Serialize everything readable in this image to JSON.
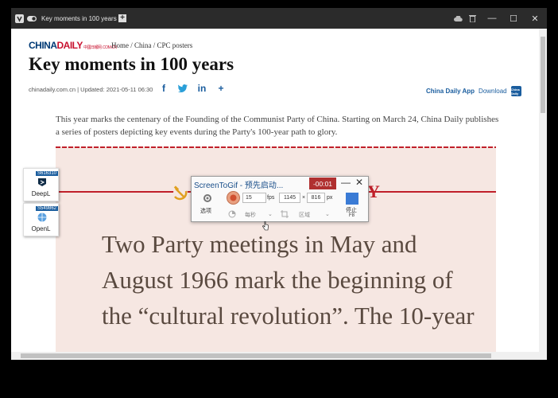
{
  "window": {
    "tab_title": "Key moments in 100 years",
    "new_tab_label": "+",
    "minimize": "—",
    "maximize": "☐",
    "close": "✕"
  },
  "colors": {
    "accent_blue": "#1a5d9e",
    "brand_red": "#c8102e",
    "poster_bg": "#f6e7e2"
  },
  "site": {
    "logo_main": "CHINA",
    "logo_accent": "DAILY",
    "logo_small": "中國日報网 .COM.CN",
    "breadcrumb": "Home / China / CPC posters",
    "headline": "Key moments in 100 years",
    "meta": "chinadaily.com.cn | Updated: 2021-05-11 06:30",
    "share": {
      "facebook": "f",
      "twitter": "t",
      "linkedin": "in",
      "more": "+"
    },
    "app_label": "China Daily App",
    "download_label": "Download",
    "app_icon_text": "China Daily",
    "lede": "This year marks the centenary of the Founding of the Communist Party of China. Starting on March 24, China Daily publishes a series of posters depicting key events during the Party's 100-year path to glory."
  },
  "poster": {
    "letter": "Y",
    "text": "Two Party meetings in May and August 1966 mark the beginning of the “cultural revolution”. The 10-year"
  },
  "side_apps": [
    {
      "name": "DeepL",
      "badge": "S616310"
    },
    {
      "name": "OpenL",
      "badge": "S549862"
    }
  ],
  "screentogif": {
    "title": "ScreenToGif - 预先启动...",
    "timer": "-00:01",
    "options_label": "选项",
    "fps_value": "15",
    "fps_label": "fps",
    "width_value": "1145",
    "times": "×",
    "height_value": "816",
    "px_label": "px",
    "per_second": "每秒",
    "region_label": "区域",
    "stop_label": "停止",
    "stop_key": "F8"
  }
}
